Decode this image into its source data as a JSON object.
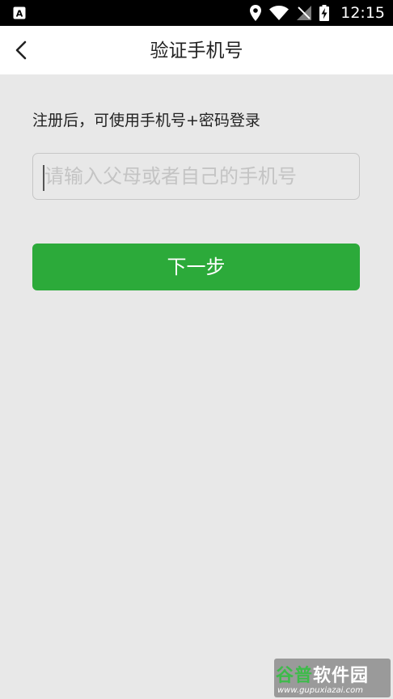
{
  "status_bar": {
    "time": "12:15",
    "icons": [
      "text-a-icon",
      "location-icon",
      "wifi-icon",
      "no-sim-icon",
      "battery-charging-icon"
    ]
  },
  "header": {
    "title": "验证手机号",
    "back_icon": "chevron-left-icon"
  },
  "main": {
    "hint": "注册后，可使用手机号+密码登录",
    "phone_input": {
      "value": "",
      "placeholder": "请输入父母或者自己的手机号"
    },
    "next_button_label": "下一步"
  },
  "watermark": {
    "brand_part1": "谷普",
    "brand_part2": "软件园",
    "url": "www.gupuxiazai.com"
  },
  "colors": {
    "accent": "#2caa3a",
    "background": "#e8e8e8",
    "header_bg": "#ffffff",
    "status_bar_bg": "#000000"
  }
}
